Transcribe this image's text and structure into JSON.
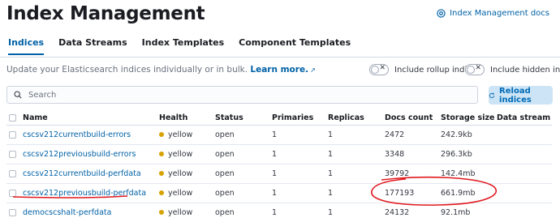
{
  "page": {
    "title": "Index Management",
    "docs_link": "Index Management docs"
  },
  "tabs": [
    {
      "label": "Indices",
      "active": true
    },
    {
      "label": "Data Streams",
      "active": false
    },
    {
      "label": "Index Templates",
      "active": false
    },
    {
      "label": "Component Templates",
      "active": false
    }
  ],
  "description": {
    "text": "Update your Elasticsearch indices individually or in bulk. ",
    "link": "Learn more."
  },
  "toggles": {
    "rollup": "Include rollup indices",
    "hidden": "Include hidden indices"
  },
  "search": {
    "placeholder": "Search"
  },
  "reload_button": "Reload indices",
  "table": {
    "headers": [
      "Name",
      "Health",
      "Status",
      "Primaries",
      "Replicas",
      "Docs count",
      "Storage size",
      "Data stream"
    ],
    "rows": [
      {
        "name": "cscsv212currentbuild-errors",
        "health": "yellow",
        "status": "open",
        "primaries": "1",
        "replicas": "1",
        "docs": "2472",
        "size": "242.9kb",
        "stream": ""
      },
      {
        "name": "cscsv212previousbuild-errors",
        "health": "yellow",
        "status": "open",
        "primaries": "1",
        "replicas": "1",
        "docs": "3348",
        "size": "296.3kb",
        "stream": ""
      },
      {
        "name": "cscsv212currentbuild-perfdata",
        "health": "yellow",
        "status": "open",
        "primaries": "1",
        "replicas": "1",
        "docs": "39792",
        "size": "142.4mb",
        "stream": ""
      },
      {
        "name": "cscsv212previousbuild-perfdata",
        "health": "yellow",
        "status": "open",
        "primaries": "1",
        "replicas": "1",
        "docs": "177193",
        "size": "661.9mb",
        "stream": ""
      },
      {
        "name": "democscshalt-perfdata",
        "health": "yellow",
        "status": "open",
        "primaries": "1",
        "replicas": "1",
        "docs": "24132",
        "size": "92.1mb",
        "stream": ""
      }
    ]
  },
  "colors": {
    "accent": "#0061a6",
    "health_yellow": "#d6a200",
    "annotation": "#e0191f"
  },
  "icons": {
    "docs": "book-icon",
    "search": "search-icon",
    "reload": "refresh-icon",
    "external": "external-link-icon"
  }
}
